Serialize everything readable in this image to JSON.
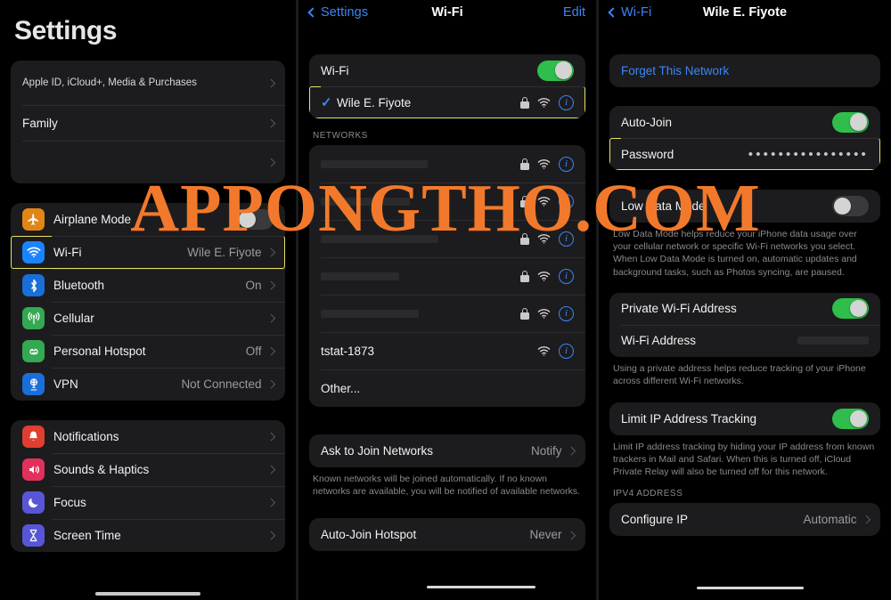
{
  "watermark": "APPONGTHO.COM",
  "watermark_color": "#f2792b",
  "accent_blue": "#3b86f7",
  "toggle_on_color": "#2fbe4b",
  "highlight_color": "#e8e163",
  "sidebar": {
    "title": "Settings",
    "account_group": [
      {
        "label": "Apple ID, iCloud+, Media & Purchases"
      },
      {
        "label": "Family"
      }
    ],
    "connectivity_group": [
      {
        "label": "Airplane Mode",
        "icon": "airplane-icon",
        "icon_color": "#e08617",
        "control": "toggle",
        "toggle": "off"
      },
      {
        "label": "Wi-Fi",
        "icon": "wifi-icon",
        "icon_color": "#1a84ff",
        "value": "Wile E. Fiyote",
        "control": "chevron",
        "highlighted": true
      },
      {
        "label": "Bluetooth",
        "icon": "bluetooth-icon",
        "icon_color": "#1a6ed8",
        "value": "On",
        "control": "chevron"
      },
      {
        "label": "Cellular",
        "icon": "cellular-icon",
        "icon_color": "#34a853",
        "value": "",
        "control": "chevron"
      },
      {
        "label": "Personal Hotspot",
        "icon": "hotspot-icon",
        "icon_color": "#34a853",
        "value": "Off",
        "control": "chevron"
      },
      {
        "label": "VPN",
        "icon": "vpn-icon",
        "icon_color": "#1a6ed8",
        "value": "Not Connected",
        "control": "chevron"
      }
    ],
    "system_group": [
      {
        "label": "Notifications",
        "icon": "bell-icon",
        "icon_color": "#e03e2f"
      },
      {
        "label": "Sounds & Haptics",
        "icon": "speaker-icon",
        "icon_color": "#e0315c"
      },
      {
        "label": "Focus",
        "icon": "moon-icon",
        "icon_color": "#5856d6"
      },
      {
        "label": "Screen Time",
        "icon": "hourglass-icon",
        "icon_color": "#5856d6"
      }
    ]
  },
  "wifi_pane": {
    "back_label": "Settings",
    "title": "Wi-Fi",
    "edit_label": "Edit",
    "wifi_toggle_label": "Wi-Fi",
    "wifi_toggle_state": "on",
    "connected_network": {
      "name": "Wile E. Fiyote",
      "secured": true,
      "highlighted": true
    },
    "networks_header": "NETWORKS",
    "networks": [
      {
        "name": "",
        "redacted": true,
        "secured": true
      },
      {
        "name": "",
        "redacted": true,
        "secured": true
      },
      {
        "name": "",
        "redacted": true,
        "secured": true
      },
      {
        "name": "",
        "redacted": true,
        "secured": true
      },
      {
        "name": "",
        "redacted": true,
        "secured": true
      },
      {
        "name": "tstat-1873",
        "redacted": false,
        "secured": false
      }
    ],
    "other_label": "Other...",
    "ask_to_join": {
      "label": "Ask to Join Networks",
      "value": "Notify"
    },
    "ask_footnote": "Known networks will be joined automatically. If no known networks are available, you will be notified of available networks.",
    "auto_join_hotspot": {
      "label": "Auto-Join Hotspot",
      "value": "Never"
    }
  },
  "network_detail": {
    "back_label": "Wi-Fi",
    "title": "Wile E. Fiyote",
    "forget_label": "Forget This Network",
    "auto_join": {
      "label": "Auto-Join",
      "state": "on"
    },
    "password": {
      "label": "Password",
      "dots": "••••••••••••••••",
      "highlighted": true
    },
    "low_data_mode": {
      "label": "Low Data Mode",
      "state": "off"
    },
    "low_data_footnote": "Low Data Mode helps reduce your iPhone data usage over your cellular network or specific Wi-Fi networks you select. When Low Data Mode is turned on, automatic updates and background tasks, such as Photos syncing, are paused.",
    "private_address": {
      "label": "Private Wi-Fi Address",
      "state": "on"
    },
    "wifi_address": {
      "label": "Wi-Fi Address",
      "value": ""
    },
    "private_footnote": "Using a private address helps reduce tracking of your iPhone across different Wi-Fi networks.",
    "limit_ip": {
      "label": "Limit IP Address Tracking",
      "state": "on"
    },
    "limit_ip_footnote": "Limit IP address tracking by hiding your IP address from known trackers in Mail and Safari. When this is turned off, iCloud Private Relay will also be turned off for this network.",
    "ipv4_header": "IPV4 ADDRESS",
    "configure_ip": {
      "label": "Configure IP",
      "value": "Automatic"
    }
  }
}
